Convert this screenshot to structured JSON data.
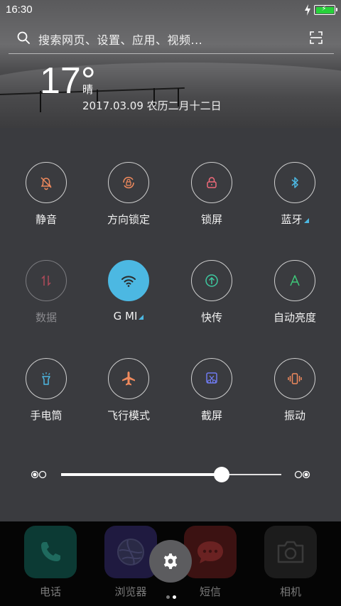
{
  "status_bar": {
    "time": "16:30",
    "battery_color": "#27d13a"
  },
  "search": {
    "placeholder": "搜索网页、设置、应用、视频..."
  },
  "weather": {
    "temperature": "17°",
    "condition": "晴",
    "date": "2017.03.09  农历二月十二日"
  },
  "toggles": [
    {
      "label": "静音",
      "icon": "bell-mute-icon",
      "color": "#f08a5d",
      "state": "off"
    },
    {
      "label": "方向锁定",
      "icon": "rotation-lock-icon",
      "color": "#f08a5d",
      "state": "off"
    },
    {
      "label": "锁屏",
      "icon": "lock-icon",
      "color": "#f06a7a",
      "state": "off"
    },
    {
      "label": "蓝牙",
      "icon": "bluetooth-icon",
      "color": "#4cb8e2",
      "state": "off",
      "has_menu": true
    },
    {
      "label": "数据",
      "icon": "data-arrows-icon",
      "color": "#b04a5a",
      "state": "disabled"
    },
    {
      "label": "G    MI",
      "icon": "wifi-icon",
      "color": "#ffffff",
      "state": "on",
      "has_menu": true
    },
    {
      "label": "快传",
      "icon": "quick-transfer-icon",
      "color": "#3ec9a0",
      "state": "off"
    },
    {
      "label": "自动亮度",
      "icon": "auto-brightness-icon",
      "color": "#3ec97a",
      "state": "off"
    },
    {
      "label": "手电筒",
      "icon": "flashlight-icon",
      "color": "#4cb8e2",
      "state": "off"
    },
    {
      "label": "飞行模式",
      "icon": "airplane-icon",
      "color": "#f08a5d",
      "state": "off"
    },
    {
      "label": "截屏",
      "icon": "screenshot-icon",
      "color": "#6f7bf0",
      "state": "off"
    },
    {
      "label": "振动",
      "icon": "vibrate-icon",
      "color": "#f08a5d",
      "state": "off"
    }
  ],
  "brightness": {
    "level": 0.73
  },
  "dock": [
    {
      "name": "电话",
      "icon": "phone-icon",
      "color": "#0c3a34"
    },
    {
      "name": "浏览器",
      "icon": "browser-icon",
      "color": "#1f1a40"
    },
    {
      "name": "短信",
      "icon": "message-icon",
      "color": "#3c1212"
    },
    {
      "name": "相机",
      "icon": "camera-icon",
      "color": "#1c1c1c"
    }
  ],
  "settings_fab": {
    "icon": "gear-icon"
  },
  "page_indicator": {
    "pages": 2,
    "current": 1
  }
}
